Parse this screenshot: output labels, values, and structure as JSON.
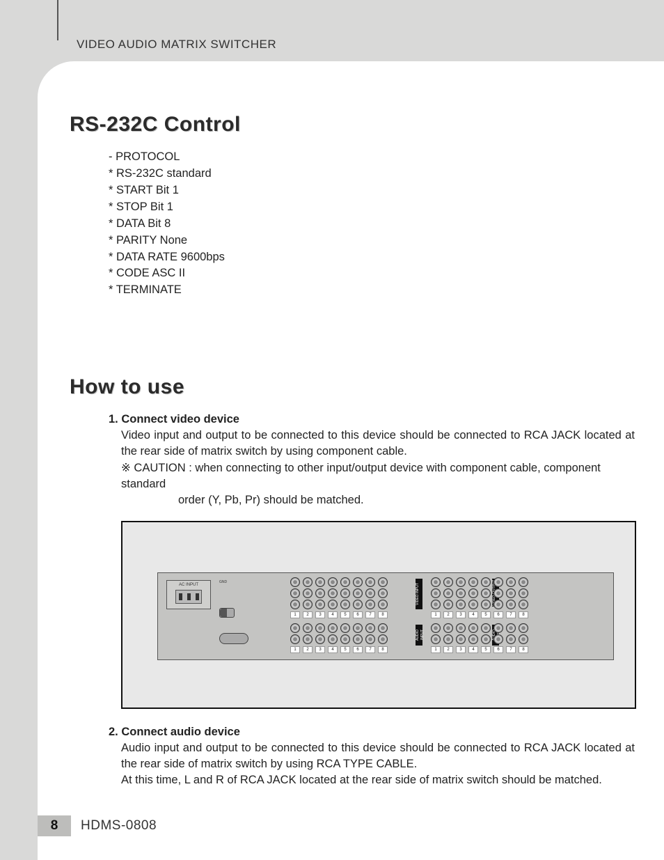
{
  "header": {
    "product_line": "VIDEO AUDIO MATRIX SWITCHER"
  },
  "section1": {
    "title": "RS-232C Control",
    "lines": [
      "-  PROTOCOL",
      "* RS-232C standard",
      "* START Bit 1",
      "* STOP Bit 1",
      "* DATA Bit 8",
      "* PARITY None",
      "* DATA RATE 9600bps",
      "* CODE ASC II",
      "* TERMINATE"
    ]
  },
  "section2": {
    "title": "How to use",
    "step1": {
      "heading": "1. Connect video device",
      "body": "Video input and output to be connected to this device should be connected to RCA JACK located at the rear side of matrix switch by using component cable.",
      "caution1": "※ CAUTION : when connecting to other input/output device with component cable, component standard",
      "caution2": "order (Y, Pb, Pr) should be matched."
    },
    "diagram": {
      "ac_label": "AC INPUT",
      "video_input": "VIDEO INPUT",
      "video_output": "VIDEO OUTPUT",
      "audio_input": "AUDIO INPUT",
      "audio_output": "AUDIO OUTPUT",
      "channels": [
        "1",
        "2",
        "3",
        "4",
        "5",
        "6",
        "7",
        "8"
      ]
    },
    "step2": {
      "heading": "2. Connect audio device",
      "body1": "Audio input and output to be connected to this device should be connected to RCA JACK located at the rear side of matrix switch by using RCA TYPE CABLE.",
      "body2": "At this time, L and R of RCA JACK located at the rear side of matrix switch should be matched."
    }
  },
  "footer": {
    "page": "8",
    "model": "HDMS-0808"
  }
}
